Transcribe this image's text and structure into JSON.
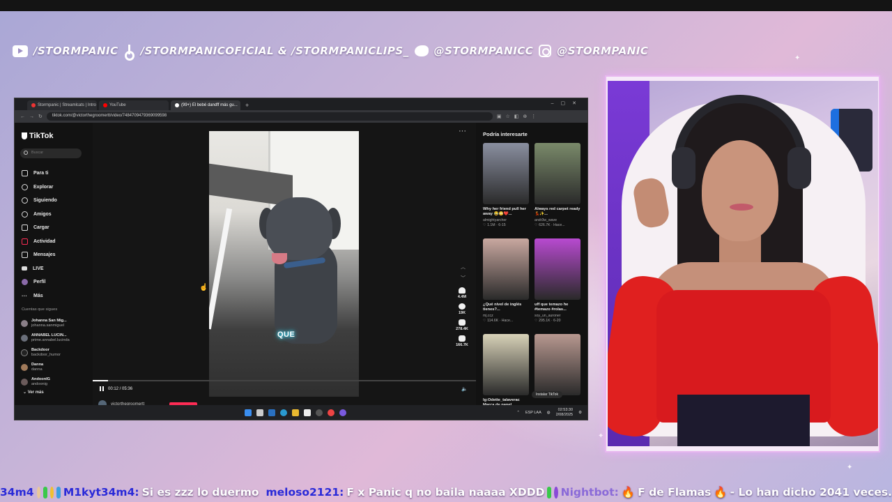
{
  "socials": {
    "youtube": "/STORMPANIC",
    "tiktok": "/STORMPANICOFICIAL & /STORMPANICLIPS_",
    "twitter": "@STORMPANICC",
    "instagram": "@STORMPANIC"
  },
  "browser": {
    "tabs": [
      "Stormpanic | Streamlcats | Intro",
      "YouTube",
      "(99+) El bebé dandff más gu..."
    ],
    "url": "tiktok.com/@victorthegroomertt/video/7484709479369099598"
  },
  "tiktok": {
    "logo": "TikTok",
    "search_placeholder": "Buscar",
    "nav": [
      "Para ti",
      "Explorar",
      "Siguiendo",
      "Amigos",
      "Cargar",
      "Actividad",
      "Mensajes",
      "LIVE",
      "Perfil",
      "Más"
    ],
    "following_title": "Cuentas que sigues",
    "following": [
      {
        "name": "Johanna San Mig...",
        "handle": "johanna.sanmiguel"
      },
      {
        "name": "ANNABEL LUCIN...",
        "handle": "prime.annabel.lucinda"
      },
      {
        "name": "Backdoor",
        "handle": "backdoor_humor"
      },
      {
        "name": "Danna",
        "handle": "danna"
      },
      {
        "name": "AndoonIG",
        "handle": "andoonig"
      }
    ],
    "ver_mas": "Ver más",
    "video": {
      "caption": "QUE",
      "likes": "4.4M",
      "comments": "19K",
      "saves": "278.4K",
      "shares": "166.7K",
      "time": "00:12 / 05:36",
      "progress": 0.04,
      "author": "victorthegroomertt"
    },
    "recs_title": "Podría interesarte",
    "recs": [
      {
        "title": "Why her friend pull her away 😂😳❤️...",
        "user": "almightyarcher",
        "meta": "♡ 1.1M · 6-15",
        "color": "#8a8fa0"
      },
      {
        "title": "Always red carpet ready💃✨...",
        "user": "andr3w_wave",
        "meta": "♡ 626.7K · Hace...",
        "color": "#7a8a6a"
      },
      {
        "title": "¿Qué nivel de inglés tienes?...",
        "user": "mj.ccz",
        "meta": "♡ 114.6K · Hace...",
        "color": "#c9a8a0"
      },
      {
        "title": "uff que temazo he #temazo #rolas...",
        "user": "soy_un_auroner",
        "meta": "♡ 295.1K · 6-20",
        "color": "#b84ad0"
      },
      {
        "title": "lg:Odette_talaverac Marca de papel...",
        "user": "",
        "meta": "",
        "color": "#d8d2b8"
      },
      {
        "title": "",
        "user": "",
        "meta": "",
        "color": "#b89890"
      }
    ],
    "install": "Instalar TikTok"
  },
  "taskbar": {
    "lang": "ESP LAA",
    "time": "02:53:30",
    "date": "2/08/2025"
  },
  "chat": [
    {
      "user": "34m4",
      "msg": ""
    },
    {
      "user": "M1kyt34m4:",
      "msg": "Si es zzz lo duermo"
    },
    {
      "user": "meloso2121:",
      "msg": "F x Panic q no baila naaaa XDDD"
    },
    {
      "user": "Nightbot:",
      "msg": "F de Flamas",
      "tail": "- Lo han dicho 2041 veces."
    }
  ]
}
